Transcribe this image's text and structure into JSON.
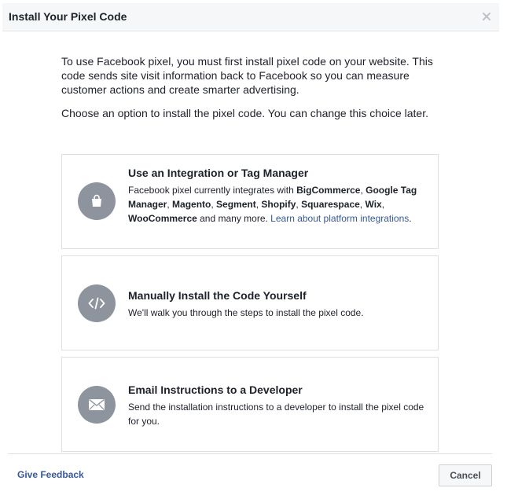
{
  "dialog": {
    "title": "Install Your Pixel Code",
    "close_icon": "close-icon"
  },
  "intro": {
    "paragraph_1": "To use Facebook pixel, you must first install pixel code on your website. This code sends site visit information back to Facebook so you can measure customer actions and create smarter advertising.",
    "paragraph_2": "Choose an option to install the pixel code. You can change this choice later."
  },
  "options": [
    {
      "icon": "shopping-bag-icon",
      "title": "Use an Integration or Tag Manager",
      "desc_prefix": "Facebook pixel currently integrates with ",
      "platforms": [
        "BigCommerce",
        "Google Tag Manager",
        "Magento",
        "Segment",
        "Shopify",
        "Squarespace",
        "Wix",
        "WooCommerce"
      ],
      "sep": ", ",
      "desc_suffix": " and many more. ",
      "link": "Learn about platform integrations",
      "link_end": "."
    },
    {
      "icon": "code-icon",
      "title": "Manually Install the Code Yourself",
      "desc": "We'll walk you through the steps to install the pixel code."
    },
    {
      "icon": "envelope-icon",
      "title": "Email Instructions to a Developer",
      "desc": "Send the installation instructions to a developer to install the pixel code for you."
    }
  ],
  "footer": {
    "feedback_label": "Give Feedback",
    "cancel_label": "Cancel"
  },
  "colors": {
    "link": "#365899",
    "icon_circle": "#8d949e",
    "border": "#dddfe2",
    "header_bg": "#f6f7f9"
  }
}
